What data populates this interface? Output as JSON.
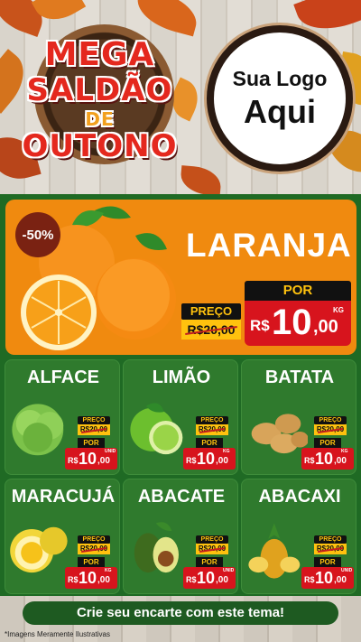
{
  "hero": {
    "badge_lines": [
      "MEGA",
      "SALDÃO",
      "DE",
      "OUTONO"
    ],
    "logo_line1": "Sua Logo",
    "logo_line2": "Aqui"
  },
  "featured": {
    "name": "LARANJA",
    "discount": "-50%",
    "preco_label": "PREÇO",
    "old_price": "R$20,00",
    "por_label": "POR",
    "currency": "R$",
    "price_int": "10",
    "price_dec": ",00",
    "unit": "KG"
  },
  "products": [
    {
      "name": "ALFACE",
      "preco_label": "PREÇO",
      "old_price": "R$20,00",
      "por_label": "POR",
      "currency": "R$",
      "price_int": "10",
      "price_dec": ",00",
      "unit": "UNID"
    },
    {
      "name": "LIMÃO",
      "preco_label": "PREÇO",
      "old_price": "R$20,00",
      "por_label": "POR",
      "currency": "R$",
      "price_int": "10",
      "price_dec": ",00",
      "unit": "KG"
    },
    {
      "name": "BATATA",
      "preco_label": "PREÇO",
      "old_price": "R$20,00",
      "por_label": "POR",
      "currency": "R$",
      "price_int": "10",
      "price_dec": ",00",
      "unit": "KG"
    },
    {
      "name": "MARACUJÁ",
      "preco_label": "PREÇO",
      "old_price": "R$20,00",
      "por_label": "POR",
      "currency": "R$",
      "price_int": "10",
      "price_dec": ",00",
      "unit": "KG"
    },
    {
      "name": "ABACATE",
      "preco_label": "PREÇO",
      "old_price": "R$20,00",
      "por_label": "POR",
      "currency": "R$",
      "price_int": "10",
      "price_dec": ",00",
      "unit": "UNID"
    },
    {
      "name": "ABACAXI",
      "preco_label": "PREÇO",
      "old_price": "R$20,00",
      "por_label": "POR",
      "currency": "R$",
      "price_int": "10",
      "price_dec": ",00",
      "unit": "UNID"
    }
  ],
  "cta": "Crie seu encarte com este tema!",
  "disclaimer": "*Imagens Meramente Ilustrativas",
  "colors": {
    "accent_red": "#d7141d",
    "tag_yellow": "#ffc20e",
    "orange": "#f08a0f",
    "green": "#2f7a2d"
  }
}
